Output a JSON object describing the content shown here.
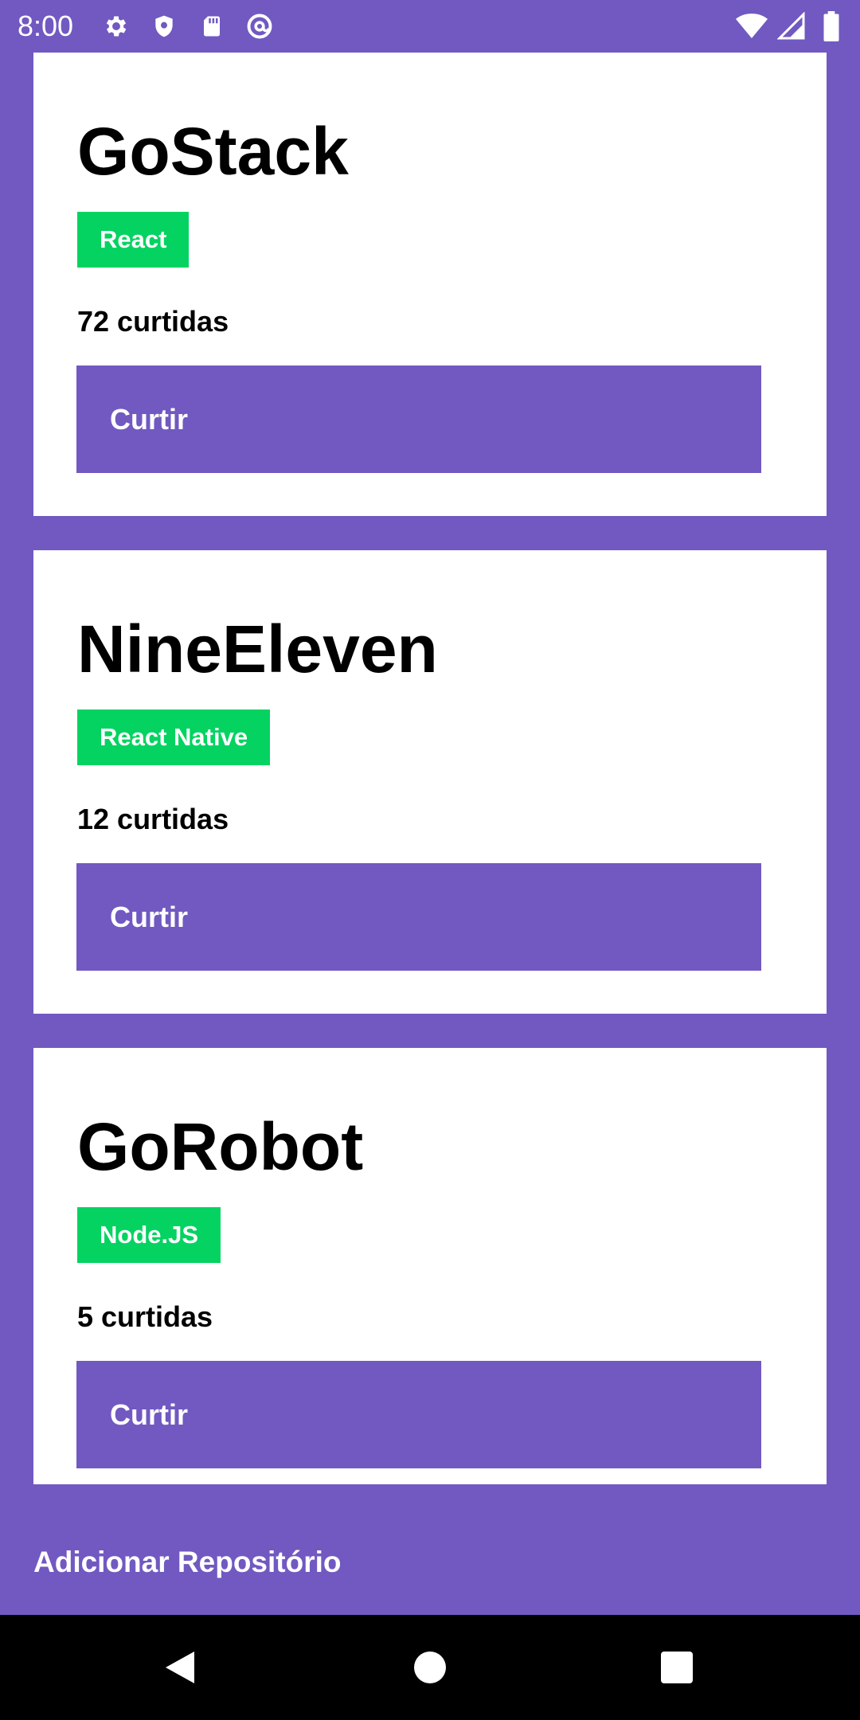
{
  "status_bar": {
    "time": "8:00",
    "left_icons": [
      "settings-gear-icon",
      "shield-icon",
      "sd-card-icon",
      "at-sign-icon"
    ],
    "right_icons": [
      "wifi-icon",
      "signal-icon",
      "battery-icon"
    ]
  },
  "repositories": [
    {
      "title": "GoStack",
      "tech": "React",
      "likes": "72 curtidas",
      "button_label": "Curtir"
    },
    {
      "title": "NineEleven",
      "tech": "React Native",
      "likes": "12 curtidas",
      "button_label": "Curtir"
    },
    {
      "title": "GoRobot",
      "tech": "Node.JS",
      "likes": "5 curtidas",
      "button_label": "Curtir"
    }
  ],
  "footer": {
    "add_button_label": "Adicionar Repositório"
  },
  "colors": {
    "background": "#7159c1",
    "card": "#ffffff",
    "badge": "#04d361",
    "button": "#7159c1",
    "nav_bar": "#000000"
  },
  "nav_bar": {
    "buttons": [
      "back-icon",
      "home-icon",
      "recents-icon"
    ]
  }
}
